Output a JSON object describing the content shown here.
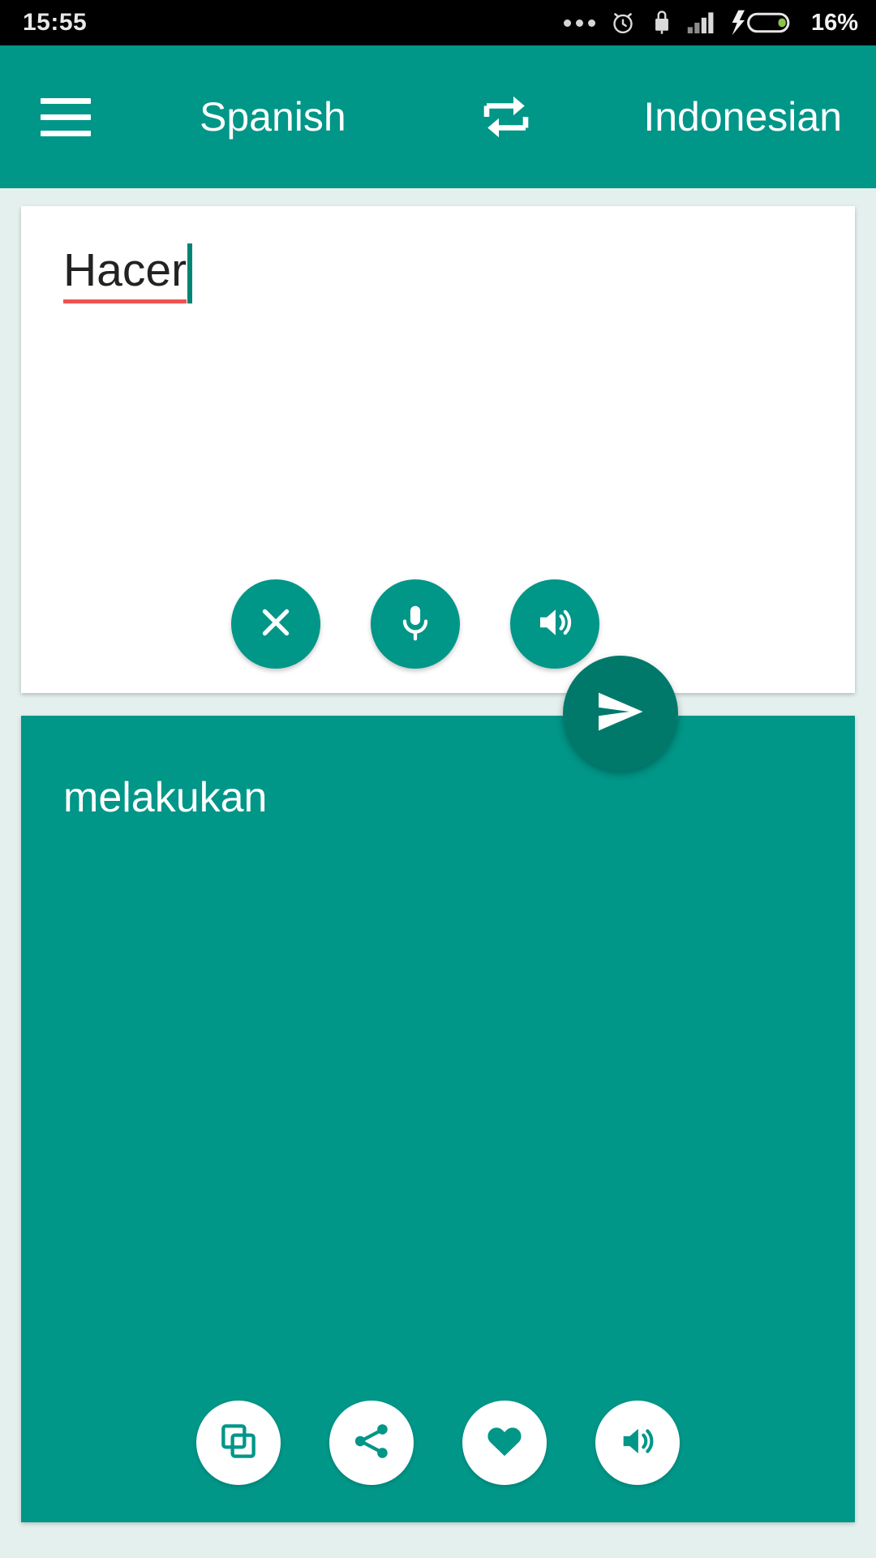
{
  "status_bar": {
    "time": "15:55",
    "battery_percent": "16%",
    "icons": [
      "more-dots-icon",
      "alarm-clock-icon",
      "usb-lock-icon",
      "signal-bars-icon",
      "battery-charging-icon"
    ]
  },
  "app_bar": {
    "menu_icon": "hamburger-menu-icon",
    "source_language": "Spanish",
    "target_language": "Indonesian",
    "swap_icon": "swap-languages-icon"
  },
  "input_card": {
    "text": "Hacer",
    "spellcheck_underline_color": "#ef5350",
    "caret_color": "#008574",
    "actions": [
      {
        "name": "clear-button",
        "icon": "close-icon"
      },
      {
        "name": "voice-input-button",
        "icon": "microphone-icon"
      },
      {
        "name": "speak-input-button",
        "icon": "speaker-icon"
      }
    ]
  },
  "send_button": {
    "name": "translate-send-button",
    "icon": "send-icon"
  },
  "output_card": {
    "text": "melakukan",
    "actions": [
      {
        "name": "copy-button",
        "icon": "copy-icon"
      },
      {
        "name": "share-button",
        "icon": "share-icon"
      },
      {
        "name": "favorite-button",
        "icon": "heart-icon"
      },
      {
        "name": "speak-output-button",
        "icon": "speaker-icon"
      }
    ]
  },
  "colors": {
    "primary": "#009688",
    "primary_dark": "#00796b",
    "background": "#e4f0ee",
    "status_bar": "#000000",
    "card": "#ffffff"
  }
}
